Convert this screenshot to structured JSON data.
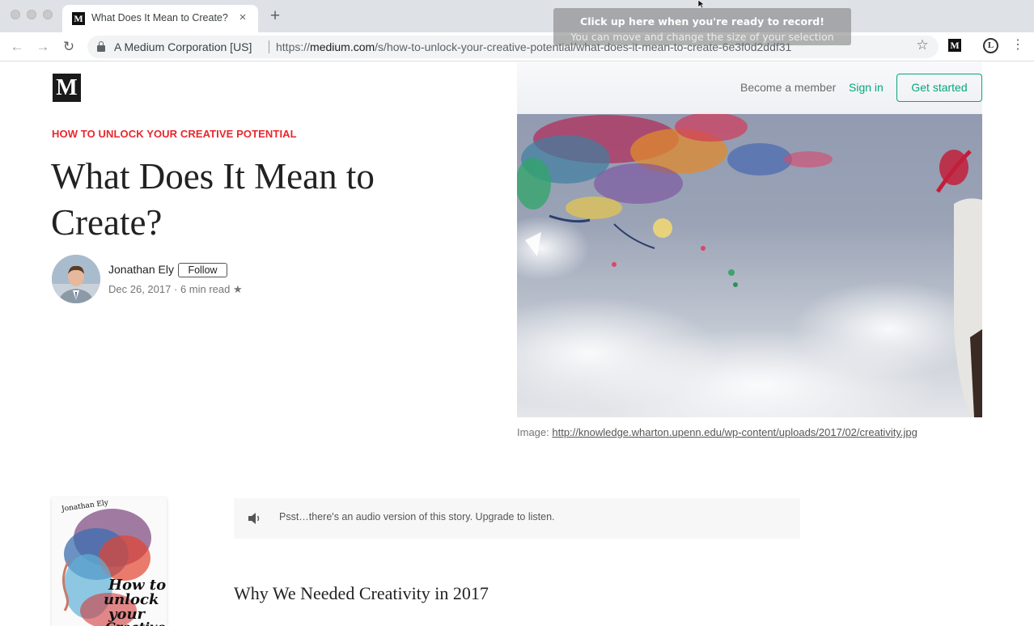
{
  "browser": {
    "tab_title": "What Does It Mean to Create?",
    "tab_close": "×",
    "new_tab": "+",
    "favicon": "M",
    "cert_name": "A Medium Corporation [US]",
    "url_scheme": "https://",
    "url_host": "medium.com",
    "url_path": "/s/how-to-unlock-your-creative-potential/what-does-it-mean-to-create-6e3f0d2ddf31",
    "back_icon": "←",
    "forward_icon": "→",
    "reload_icon": "↻",
    "bookmark_icon": "☆",
    "extension_medium": "M",
    "extension_l": "L",
    "menu_icon": "⋮"
  },
  "recorder": {
    "line1": "Click up here when you're ready to record!",
    "line2": "You can move and change the size of your selection"
  },
  "header": {
    "logo": "M",
    "become_member": "Become a member",
    "sign_in": "Sign in",
    "get_started": "Get started"
  },
  "article": {
    "kicker": "HOW TO UNLOCK YOUR CREATIVE POTENTIAL",
    "title": "What Does It Mean to Create?",
    "author": "Jonathan Ely",
    "follow": "Follow",
    "date": "Dec 26, 2017",
    "separator": "·",
    "read_time": "6 min read",
    "star": "★",
    "caption_prefix": "Image: ",
    "caption_link": "http://knowledge.wharton.upenn.edu/wp-content/uploads/2017/02/creativity.jpg"
  },
  "book": {
    "author": "Jonathan Ely",
    "title_line1": "How to",
    "title_line2": "unlock",
    "title_line3": "your",
    "title_line4": "Creative"
  },
  "audio": {
    "text": "Psst…there's an audio version of this story. Upgrade to listen."
  },
  "section": {
    "heading": "Why We Needed Creativity in 2017"
  },
  "colors": {
    "accent_green": "#03a87c",
    "kicker_red": "#e8272d",
    "chrome_bg": "#dee1e6"
  }
}
